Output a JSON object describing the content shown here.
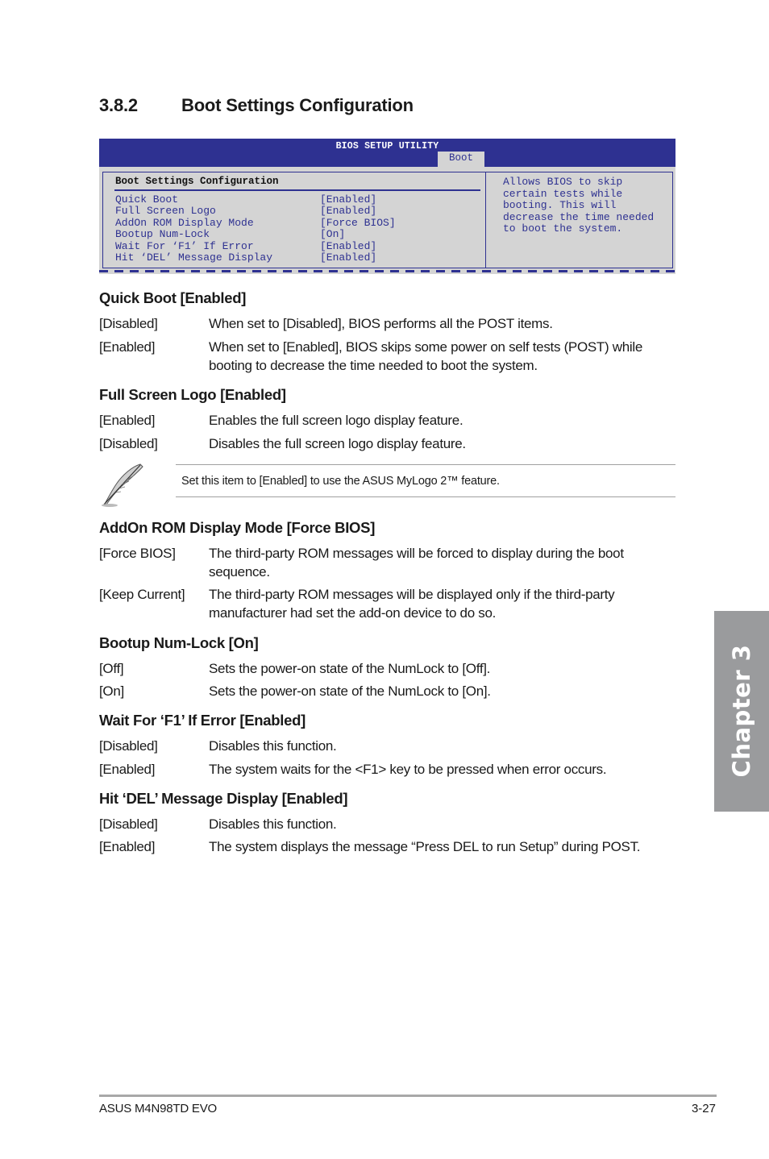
{
  "section": {
    "number": "3.8.2",
    "title": "Boot Settings Configuration"
  },
  "bios": {
    "title": "BIOS SETUP UTILITY",
    "active_tab": "Boot",
    "panel_title": "Boot Settings Configuration",
    "items": [
      {
        "label": "Quick Boot",
        "value": "[Enabled]"
      },
      {
        "label": "Full Screen Logo",
        "value": "[Enabled]"
      },
      {
        "label": "AddOn ROM Display Mode",
        "value": "[Force BIOS]"
      },
      {
        "label": "Bootup Num-Lock",
        "value": "[On]"
      },
      {
        "label": "Wait For ‘F1’ If Error",
        "value": "[Enabled]"
      },
      {
        "label": "Hit ‘DEL’ Message Display",
        "value": "[Enabled]"
      }
    ],
    "help_text": "Allows BIOS to skip certain tests while booting. This will decrease the time needed to boot the system.",
    "colors": {
      "primary": "#2e3191",
      "background": "#d4d4d4"
    }
  },
  "items": [
    {
      "heading": "Quick Boot [Enabled]",
      "options": [
        {
          "key": "[Disabled]",
          "desc": "When set to [Disabled], BIOS performs all the POST items."
        },
        {
          "key": "[Enabled]",
          "desc": "When set to [Enabled], BIOS skips some power on self tests (POST) while booting to decrease the time needed to boot the system."
        }
      ]
    },
    {
      "heading": "Full Screen Logo [Enabled]",
      "options": [
        {
          "key": "[Enabled]",
          "desc": "Enables the full screen logo display feature."
        },
        {
          "key": "[Disabled]",
          "desc": "Disables the full screen logo display feature."
        }
      ]
    },
    {
      "heading": "AddOn ROM Display Mode [Force BIOS]",
      "options": [
        {
          "key": "[Force BIOS]",
          "desc": "The third-party ROM messages will be forced to display during the boot sequence."
        },
        {
          "key": "[Keep Current]",
          "desc": "The third-party ROM messages will be displayed only if the third-party manufacturer had set the add-on device to do so."
        }
      ]
    },
    {
      "heading": "Bootup Num-Lock [On]",
      "options": [
        {
          "key": "[Off]",
          "desc": "Sets the power-on state of the NumLock to [Off]."
        },
        {
          "key": "[On]",
          "desc": "Sets the power-on state of the NumLock to [On]."
        }
      ]
    },
    {
      "heading": "Wait For ‘F1’ If Error [Enabled]",
      "options": [
        {
          "key": "[Disabled]",
          "desc": "Disables this function."
        },
        {
          "key": "[Enabled]",
          "desc": "The system waits for the <F1> key to be pressed when error occurs."
        }
      ]
    },
    {
      "heading": "Hit ‘DEL’ Message Display [Enabled]",
      "options": [
        {
          "key": "[Disabled]",
          "desc": "Disables this function."
        },
        {
          "key": "[Enabled]",
          "desc": "The system displays the message “Press DEL to run Setup” during POST."
        }
      ]
    }
  ],
  "note": {
    "icon": "feather-pen-icon",
    "text": "Set this item to [Enabled] to use the ASUS MyLogo 2™ feature."
  },
  "chapter_tab": {
    "label": "Chapter 3"
  },
  "footer": {
    "product": "ASUS M4N98TD EVO",
    "page": "3-27"
  }
}
